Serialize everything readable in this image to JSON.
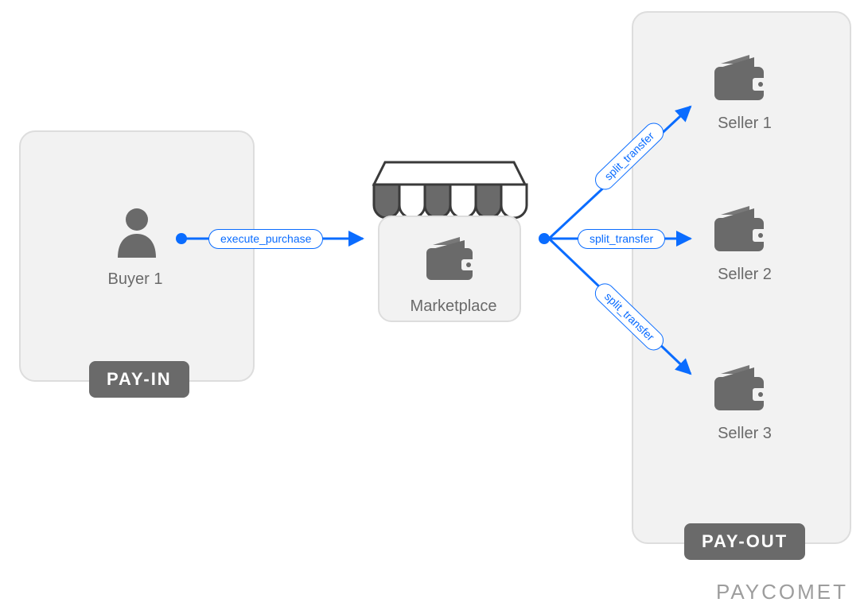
{
  "buyer": {
    "label": "Buyer 1",
    "tag": "PAY-IN"
  },
  "marketplace": {
    "label": "Marketplace"
  },
  "sellers": {
    "tag": "PAY-OUT",
    "items": [
      {
        "label": "Seller 1"
      },
      {
        "label": "Seller 2"
      },
      {
        "label": "Seller 3"
      }
    ]
  },
  "edges": {
    "purchase": "execute_purchase",
    "split1": "split_transfer",
    "split2": "split_transfer",
    "split3": "split_transfer"
  },
  "brand": "PAYCOMET"
}
